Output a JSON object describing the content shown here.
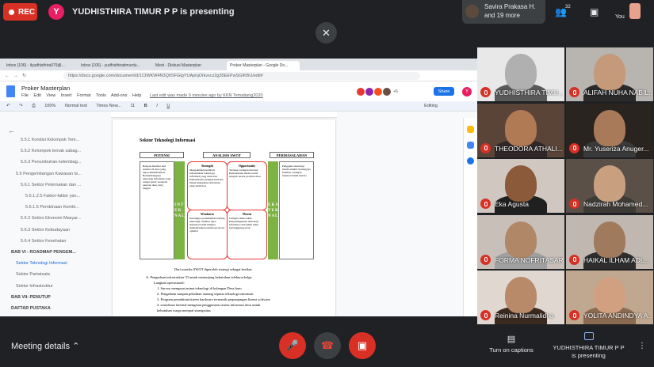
{
  "topbar": {
    "rec_label": "REC",
    "presenter_initial": "Y",
    "presenter_text": "YUDHISTHIRA TIMUR P P is presenting",
    "notification_line1": "Savira Prakasa H.",
    "notification_line2": "and 19 more",
    "participant_count": "32",
    "you_label": "You"
  },
  "browser": {
    "tabs": [
      "Inbox (106) - ilyudhisthira079@...",
      "Inbox (106) - yudhisthiratimurdu...",
      "Meet - Diskusi Masterplan",
      "Proker Masterplan - Google Do..."
    ],
    "url": "https://docs.google.com/document/d/1CIWKW4N3Q0SFGIgYUApIqOIkvxcz2g35EEPwSGIKBU/edit#"
  },
  "docs": {
    "title": "Proker Masterplan",
    "menus": [
      "File",
      "Edit",
      "View",
      "Insert",
      "Format",
      "Tools",
      "Add-ons",
      "Help"
    ],
    "last_edit": "Last edit was made 9 minutes ago by KKN Tematiang2020",
    "share": "Share",
    "user_initial": "Y",
    "collab_more": "+6",
    "zoom": "100%",
    "style": "Normal text",
    "font": "Times New...",
    "font_size": "11",
    "mode": "Editing"
  },
  "outline": [
    {
      "label": "5.5.1 Kondisi Kelompok Tem...",
      "indent": 26
    },
    {
      "label": "5.5.2 Kelompok ternak sabag...",
      "indent": 26
    },
    {
      "label": "5.5.3 Penumbuhan kelembag...",
      "indent": 26
    },
    {
      "label": "5.6 Pengembangan Kawasan te...",
      "indent": 20
    },
    {
      "label": "5.6.1 Sektor Peternakan dan ...",
      "indent": 26
    },
    {
      "label": "5.6.1.2.5 Faktor-faktor yan...",
      "indent": 32
    },
    {
      "label": "5.6.1.5 Pembinaan Kemitr...",
      "indent": 32
    },
    {
      "label": "5.6.2 Sektor Ekonomi Masyar...",
      "indent": 26
    },
    {
      "label": "5.6.3 Sektor Kebudayaan",
      "indent": 26
    },
    {
      "label": "5.6.4 Sektor Kesehatan",
      "indent": 26
    },
    {
      "label": "BAB VI : ROADMAP PENGEM...",
      "indent": 14
    },
    {
      "label": "Sektor Teknologi Informasi",
      "indent": 20
    },
    {
      "label": "Sektor Pariwisata",
      "indent": 20
    },
    {
      "label": "Sektor Infrastruktur",
      "indent": 20
    },
    {
      "label": "BAB VII: PENUTUP",
      "indent": 14
    },
    {
      "label": "DAFTAR PUSTAKA",
      "indent": 14
    }
  ],
  "page": {
    "heading": "Sektor Teknologi Informasi",
    "col_potensi": "POTENSI",
    "col_swot": "ANALISIS SWOT",
    "col_masalah": "PERMASALAHAN",
    "internal": "I N T E R N A L",
    "eksternal": "E K S T E R N A L",
    "potensi_items": "Banyak manfaat dari internet di desa yang dapat dimanfaatkan; Berkembangnya teknologi informasi yang sangat pesat; Generasi penerus desa yang unggul",
    "strength_title": "Strength",
    "strength_text": "Mengaktifkan kembali infrastruktur teknologi informasi yang telah ada; Pemanfaatan jaringan internet; Dapat mengakses informasi yang lebih luas",
    "weakness_title": "Weakness",
    "weakness_text": "Kurangnya pemahaman tentang teknologi; Sumber daya manusia belum mampu memanfaatkan teknologi secara optimal",
    "opportunity_title": "Opportunity",
    "opportunity_text": "Terdapat jaringan internet; Pemanfaatan media sosial sebagai sarana promosi desa",
    "threat_title": "Threat",
    "threat_text": "Jaringan tidak stabil; Penyalahgunaan teknologi informasi oleh pihak tidak bertanggung jawab",
    "masalah_items": "Pengguna teknologi masih sedikit; Kurangnya fasilitas; Jaringan internet belum merata",
    "text1": "Dari matriks SWOT diperoleh strategi sebagai berikut:",
    "text2": "A.   Pengadaan infrastruktur TI untuk menunjang kebutuhan teleknowledge",
    "text3": "Langkah operasional:",
    "steps": [
      "1.   Survey mengenai minat teknologi di kalangan Desa baru",
      "2.   Pengadaan sarapan pelatihan tentang seputar teknologi informasi",
      "3.   Program pemahiran/sistem hardware termasuk perpanjangan lisensi software",
      "4.   sosialisasi intensif mengenai penggunaan sistem informasi desa untuk",
      "      kebutuhan warga menjual sinergisitas"
    ]
  },
  "participants": [
    {
      "name": "YUDHISTHIRA TIMU...",
      "skin": "#b0b0b0",
      "cloth": "#5a5a5a",
      "bg": "#e8e8e8"
    },
    {
      "name": "ALIFAH NUHA NABIL...",
      "skin": "#c49a7a",
      "cloth": "#2a2a2a",
      "bg": "#b8b4b0"
    },
    {
      "name": "THEODORA ATHALI...",
      "skin": "#b07a55",
      "cloth": "#302828",
      "bg": "#5a4438"
    },
    {
      "name": "Mr. Yuseriza Anuger...",
      "skin": "#a97a5a",
      "cloth": "#3a3a3a",
      "bg": "#2a2420"
    },
    {
      "name": "Eka Agusta",
      "skin": "#8a5a3a",
      "cloth": "#202020",
      "bg": "#d0c8c0"
    },
    {
      "name": "Nadzirah Mohamed...",
      "skin": "#c8a080",
      "cloth": "#3e3a36",
      "bg": "#5a5048"
    },
    {
      "name": "FORMA NOFRITASARI",
      "skin": "#b08868",
      "cloth": "#a0a0a0",
      "bg": "#c8c0b8"
    },
    {
      "name": "HAIKAL ILHAM ADL...",
      "skin": "#a07a5c",
      "cloth": "#2e2e2e",
      "bg": "#c0b8b0"
    },
    {
      "name": "Reinina Nurmalidha",
      "skin": "#b88a6a",
      "cloth": "#3a2a20",
      "bg": "#e0d8d0"
    },
    {
      "name": "YOLITA ANDINDYA A...",
      "skin": "#d0a080",
      "cloth": "#8a6a50",
      "bg": "#c0a890"
    }
  ],
  "bottom": {
    "meeting_details": "Meeting details",
    "captions_label": "Turn on captions",
    "presenting_line1": "YUDHISTHIRA TIMUR P P",
    "presenting_line2": "is presenting"
  },
  "colors": {
    "red": "#d93025",
    "meet_bg": "#202124",
    "docs_blue": "#1a73e8"
  }
}
